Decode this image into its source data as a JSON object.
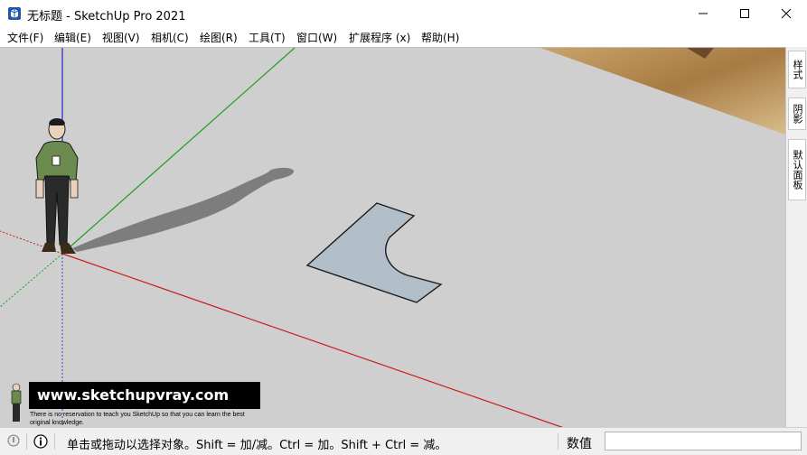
{
  "window": {
    "title": "无标题 - SketchUp Pro 2021",
    "controls": {
      "minimize": "—",
      "maximize": "☐",
      "close": "✕"
    }
  },
  "menu": {
    "items": [
      "文件(F)",
      "编辑(E)",
      "视图(V)",
      "相机(C)",
      "绘图(R)",
      "工具(T)",
      "窗口(W)",
      "扩展程序 (x)",
      "帮助(H)"
    ]
  },
  "tray": {
    "tabs": [
      "样式",
      "阴影",
      "默认面板"
    ]
  },
  "watermark": {
    "site": "www.sketchupvray.com",
    "tagline": "There is no reservation to teach you SketchUp so that you can learn the best original knowledge."
  },
  "status": {
    "hint": "单击或拖动以选择对象。Shift = 加/减。Ctrl = 加。Shift + Ctrl = 减。",
    "measurements_label": "数值",
    "measurements_value": ""
  },
  "scene": {
    "background_color": "#cfcfcf",
    "shape_fill": "#b2bec8",
    "axis_colors": {
      "red": "#c81e1e",
      "green": "#1aa01a",
      "blue": "#3c3cc8"
    }
  }
}
